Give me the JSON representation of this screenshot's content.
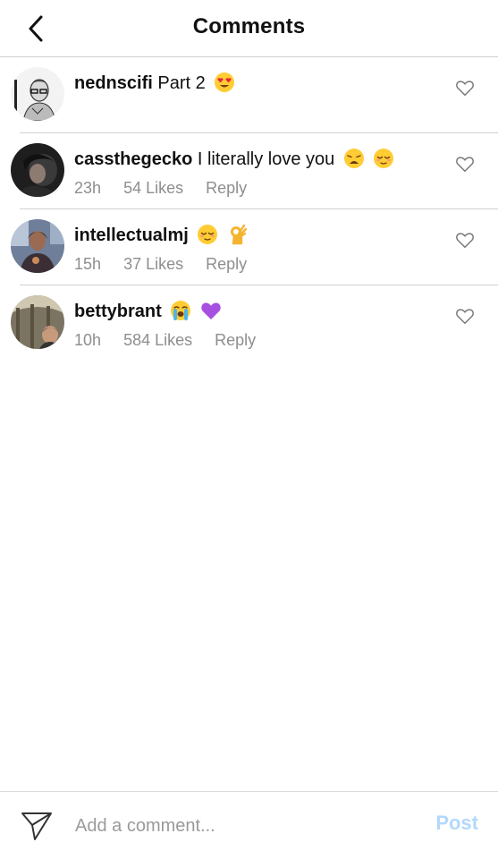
{
  "header": {
    "title": "Comments",
    "back_icon": "chevron-left-icon"
  },
  "comments": [
    {
      "username": "nednscifi",
      "text": "Part 2",
      "emojis": [
        "heart-eyes-emoji"
      ],
      "time": "",
      "likes": "",
      "reply": ""
    },
    {
      "username": "cassthegecko",
      "text": "I literally love you",
      "emojis": [
        "weary-face-emoji",
        "relieved-face-emoji"
      ],
      "time": "23h",
      "likes": "54 Likes",
      "reply": "Reply"
    },
    {
      "username": "intellectualmj",
      "text": "",
      "emojis": [
        "relieved-face-emoji",
        "ok-hand-emoji"
      ],
      "time": "15h",
      "likes": "37 Likes",
      "reply": "Reply"
    },
    {
      "username": "bettybrant",
      "text": "",
      "emojis": [
        "loudly-crying-face-emoji",
        "purple-heart-emoji"
      ],
      "time": "10h",
      "likes": "584 Likes",
      "reply": "Reply"
    }
  ],
  "footer": {
    "input_placeholder": "Add a comment...",
    "post_label": "Post",
    "post_color": "#b3d8fb"
  }
}
